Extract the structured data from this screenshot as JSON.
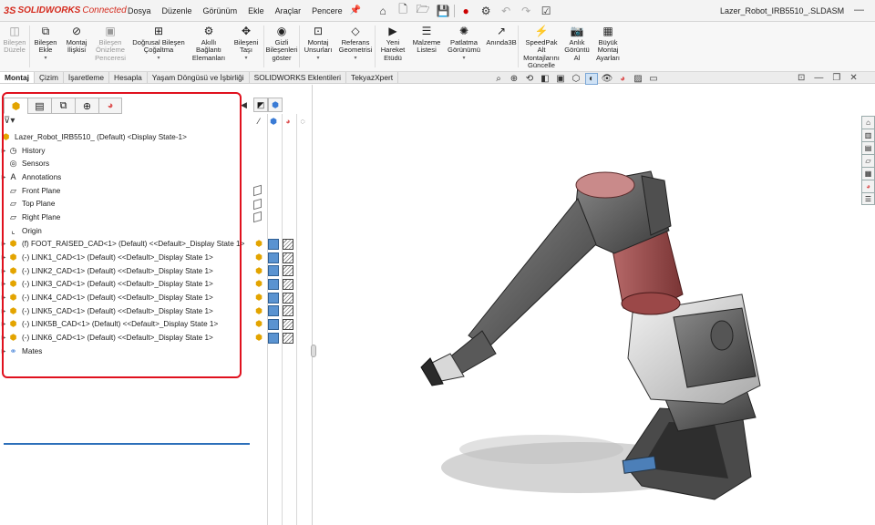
{
  "app": {
    "logo_ds": "3S",
    "logo_brand": "SOLIDWORKS",
    "logo_suffix": "Connected",
    "document_title": "Lazer_Robot_IRB5510_.SLDASM",
    "accent_color": "#d52b1e"
  },
  "menu": [
    "Dosya",
    "Düzenle",
    "Görünüm",
    "Ekle",
    "Araçlar",
    "Pencere"
  ],
  "quick_access_icons": [
    "home-icon",
    "new-icon",
    "open-icon",
    "save-icon",
    "traffic-light-icon",
    "options-icon",
    "undo-icon",
    "redo-icon",
    "checklist-icon"
  ],
  "ribbon": [
    {
      "label": "Bileşen\nDüzele",
      "icon": "◫",
      "dim": true
    },
    {
      "label": "Bileşen\nEkle",
      "icon": "⧉",
      "dim": false,
      "caret": true
    },
    {
      "label": "Montaj\nİlişkisi",
      "icon": "⊘",
      "dim": false
    },
    {
      "label": "Bileşen\nÖnizleme\nPenceresi",
      "icon": "▣",
      "dim": true
    },
    {
      "label": "Doğrusal Bileşen\nÇoğaltma",
      "icon": "⊞",
      "dim": false,
      "caret": true
    },
    {
      "label": "Akıllı\nBağlantı\nElemanları",
      "icon": "⚙",
      "dim": false
    },
    {
      "label": "Bileşeni\nTaşı",
      "icon": "✥",
      "dim": false,
      "caret": true
    },
    {
      "label": "Gizli\nBileşenleri\ngöster",
      "icon": "◉",
      "dim": false
    },
    {
      "label": "Montaj\nUnsurları",
      "icon": "⊡",
      "dim": false,
      "caret": true
    },
    {
      "label": "Referans\nGeometrisi",
      "icon": "◇",
      "dim": false,
      "caret": true
    },
    {
      "label": "Yeni\nHareket\nEtüdü",
      "icon": "▶",
      "dim": false
    },
    {
      "label": "Malzeme\nListesi",
      "icon": "☰",
      "dim": false
    },
    {
      "label": "Patlatma\nGörünümü",
      "icon": "✺",
      "dim": false,
      "caret": true
    },
    {
      "label": "Anında3B",
      "icon": "↗",
      "dim": false
    },
    {
      "label": "SpeedPak\nAlt\nMontajlarını\nGüncelle",
      "icon": "⚡",
      "dim": false
    },
    {
      "label": "Anlık\nGörüntü\nAl",
      "icon": "📷",
      "dim": false
    },
    {
      "label": "Büyük\nMontaj\nAyarları",
      "icon": "▦",
      "dim": false
    }
  ],
  "tabs": [
    "Montaj",
    "Çizim",
    "İşaretleme",
    "Hesapla",
    "Yaşam Döngüsü ve İşbirliği",
    "SOLIDWORKS Eklentileri",
    "TekyazXpert"
  ],
  "panel_tabs": [
    "featuremanager-icon",
    "propertymanager-icon",
    "configurationmanager-icon",
    "dimxpert-icon",
    "display-manager-icon"
  ],
  "tree": {
    "root": "Lazer_Robot_IRB5510_ (Default) <Display State-1>",
    "items": [
      {
        "label": "History",
        "icon": "history-icon",
        "glyph": "◷",
        "arrow": true
      },
      {
        "label": "Sensors",
        "icon": "sensors-icon",
        "glyph": "◎",
        "arrow": false
      },
      {
        "label": "Annotations",
        "icon": "annotations-icon",
        "glyph": "A",
        "arrow": true
      },
      {
        "label": "Front Plane",
        "icon": "plane-icon",
        "glyph": "▱",
        "arrow": false
      },
      {
        "label": "Top Plane",
        "icon": "plane-icon",
        "glyph": "▱",
        "arrow": false
      },
      {
        "label": "Right Plane",
        "icon": "plane-icon",
        "glyph": "▱",
        "arrow": false
      },
      {
        "label": "Origin",
        "icon": "origin-icon",
        "glyph": "⌞",
        "arrow": false
      },
      {
        "label": "(f) FOOT_RAISED_CAD<1> (Default) <<Default>_Display State 1>",
        "icon": "part-icon",
        "glyph": "⬢",
        "arrow": true
      },
      {
        "label": "(-) LINK1_CAD<1> (Default) <<Default>_Display State 1>",
        "icon": "part-icon",
        "glyph": "⬢",
        "arrow": true
      },
      {
        "label": "(-) LINK2_CAD<1> (Default) <<Default>_Display State 1>",
        "icon": "part-icon",
        "glyph": "⬢",
        "arrow": true
      },
      {
        "label": "(-) LINK3_CAD<1> (Default) <<Default>_Display State 1>",
        "icon": "part-icon",
        "glyph": "⬢",
        "arrow": true
      },
      {
        "label": "(-) LINK4_CAD<1> (Default) <<Default>_Display State 1>",
        "icon": "part-icon",
        "glyph": "⬢",
        "arrow": true
      },
      {
        "label": "(-) LINK5_CAD<1> (Default) <<Default>_Display State 1>",
        "icon": "part-icon",
        "glyph": "⬢",
        "arrow": true
      },
      {
        "label": "(-) LINK5B_CAD<1> (Default) <<Default>_Display State 1>",
        "icon": "part-icon",
        "glyph": "⬢",
        "arrow": true
      },
      {
        "label": "(-) LINK6_CAD<1> (Default) <<Default>_Display State 1>",
        "icon": "part-icon",
        "glyph": "⬢",
        "arrow": true
      },
      {
        "label": "Mates",
        "icon": "mates-icon",
        "glyph": "⚭",
        "arrow": true
      }
    ]
  }
}
